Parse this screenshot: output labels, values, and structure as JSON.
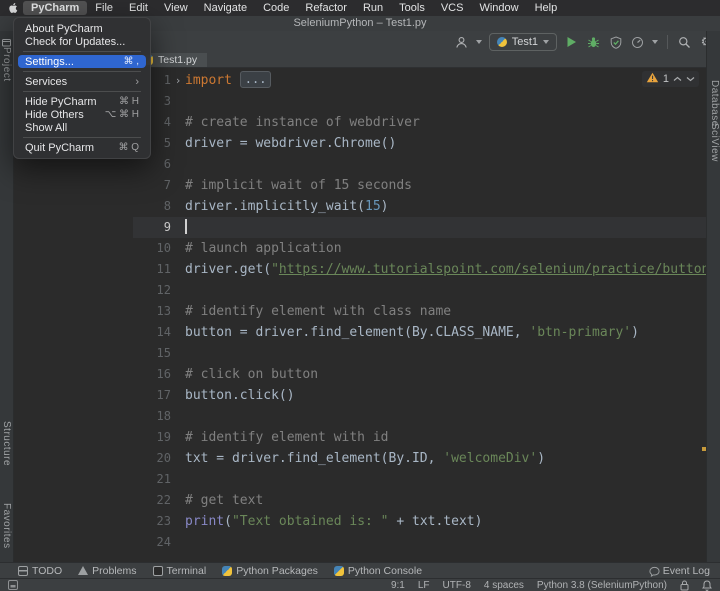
{
  "colors": {
    "accent_blue": "#2f66d0",
    "run_green": "#5fad65",
    "warning_yellow": "#e8a33d",
    "editor_background": "#2b2b2b",
    "chrome_background": "#3c3f41",
    "keyword": "#cc7832",
    "string": "#6a8759",
    "number": "#6897bb",
    "comment": "#808080",
    "builtin": "#8888c6",
    "code_text": "#a9b7c6"
  },
  "menubar": {
    "items": [
      "PyCharm",
      "File",
      "Edit",
      "View",
      "Navigate",
      "Code",
      "Refactor",
      "Run",
      "Tools",
      "VCS",
      "Window",
      "Help"
    ],
    "active_item": "PyCharm"
  },
  "titlebar": {
    "title": "SeleniumPython – Test1.py"
  },
  "pycharm_menu": {
    "items": [
      {
        "label": "About PyCharm"
      },
      {
        "label": "Check for Updates..."
      },
      {
        "sep": true
      },
      {
        "label": "Settings...",
        "shortcut": "⌘ ,",
        "selected": true
      },
      {
        "sep": true
      },
      {
        "label": "Services",
        "submenu": true
      },
      {
        "sep": true
      },
      {
        "label": "Hide PyCharm",
        "shortcut": "⌘ H"
      },
      {
        "label": "Hide Others",
        "shortcut": "⌥ ⌘ H"
      },
      {
        "label": "Show All"
      },
      {
        "sep": true
      },
      {
        "label": "Quit PyCharm",
        "shortcut": "⌘ Q"
      }
    ]
  },
  "toolbar": {
    "run_config": "Test1"
  },
  "tab_bar": {
    "active_tab": "Test1.py"
  },
  "tool_stripes": {
    "left": [
      "Project",
      "Structure",
      "Favorites"
    ],
    "right": [
      "Database",
      "SciView"
    ]
  },
  "editor": {
    "warning_count": "1",
    "lines": [
      {
        "num": "1",
        "fold": true,
        "segs": [
          {
            "t": "import",
            "c": "kw"
          },
          {
            "t": " ",
            "c": ""
          },
          {
            "t": "...",
            "c": "fold"
          }
        ]
      },
      {
        "num": "3",
        "segs": []
      },
      {
        "num": "4",
        "segs": [
          {
            "t": "# create instance of webdriver",
            "c": "com"
          }
        ]
      },
      {
        "num": "5",
        "segs": [
          {
            "t": "driver = webdriver.Chrome()",
            "c": ""
          }
        ]
      },
      {
        "num": "6",
        "segs": []
      },
      {
        "num": "7",
        "segs": [
          {
            "t": "# implicit wait of 15 seconds",
            "c": "com"
          }
        ]
      },
      {
        "num": "8",
        "segs": [
          {
            "t": "driver.implicitly_wait(",
            "c": ""
          },
          {
            "t": "15",
            "c": "num"
          },
          {
            "t": ")",
            "c": ""
          }
        ]
      },
      {
        "num": "9",
        "cursor": true,
        "segs": []
      },
      {
        "num": "10",
        "segs": [
          {
            "t": "# launch application",
            "c": "com"
          }
        ]
      },
      {
        "num": "11",
        "segs": [
          {
            "t": "driver.get(",
            "c": ""
          },
          {
            "t": "\"",
            "c": "str"
          },
          {
            "t": "https://www.tutorialspoint.com/selenium/practice/buttons.",
            "c": "strl"
          }
        ]
      },
      {
        "num": "12",
        "segs": []
      },
      {
        "num": "13",
        "segs": [
          {
            "t": "# identify element with class name",
            "c": "com"
          }
        ]
      },
      {
        "num": "14",
        "segs": [
          {
            "t": "button = driver.find_element(By.CLASS_NAME, ",
            "c": ""
          },
          {
            "t": "'btn-primary'",
            "c": "str"
          },
          {
            "t": ")",
            "c": ""
          }
        ]
      },
      {
        "num": "15",
        "segs": []
      },
      {
        "num": "16",
        "segs": [
          {
            "t": "# click on button",
            "c": "com"
          }
        ]
      },
      {
        "num": "17",
        "segs": [
          {
            "t": "button.click()",
            "c": ""
          }
        ]
      },
      {
        "num": "18",
        "segs": []
      },
      {
        "num": "19",
        "segs": [
          {
            "t": "# identify element with id",
            "c": "com"
          }
        ]
      },
      {
        "num": "20",
        "segs": [
          {
            "t": "txt = driver.find_element(By.ID, ",
            "c": ""
          },
          {
            "t": "'welcomeDiv'",
            "c": "str"
          },
          {
            "t": ")",
            "c": ""
          }
        ]
      },
      {
        "num": "21",
        "segs": []
      },
      {
        "num": "22",
        "segs": [
          {
            "t": "# get text",
            "c": "com"
          }
        ]
      },
      {
        "num": "23",
        "segs": [
          {
            "t": "print",
            "c": "bi"
          },
          {
            "t": "(",
            "c": ""
          },
          {
            "t": "\"Text obtained is: \"",
            "c": "str"
          },
          {
            "t": " + txt.text)",
            "c": ""
          }
        ]
      },
      {
        "num": "24",
        "segs": []
      }
    ]
  },
  "bottom_bar": {
    "items": [
      {
        "label": "TODO"
      },
      {
        "label": "Problems"
      },
      {
        "label": "Terminal"
      },
      {
        "label": "Python Packages"
      },
      {
        "label": "Python Console"
      }
    ],
    "event_log": "Event Log"
  },
  "status_bar": {
    "cursor_position": "9:1",
    "line_ending": "LF",
    "encoding": "UTF-8",
    "indent": "4 spaces",
    "interpreter": "Python 3.8 (SeleniumPython)"
  }
}
